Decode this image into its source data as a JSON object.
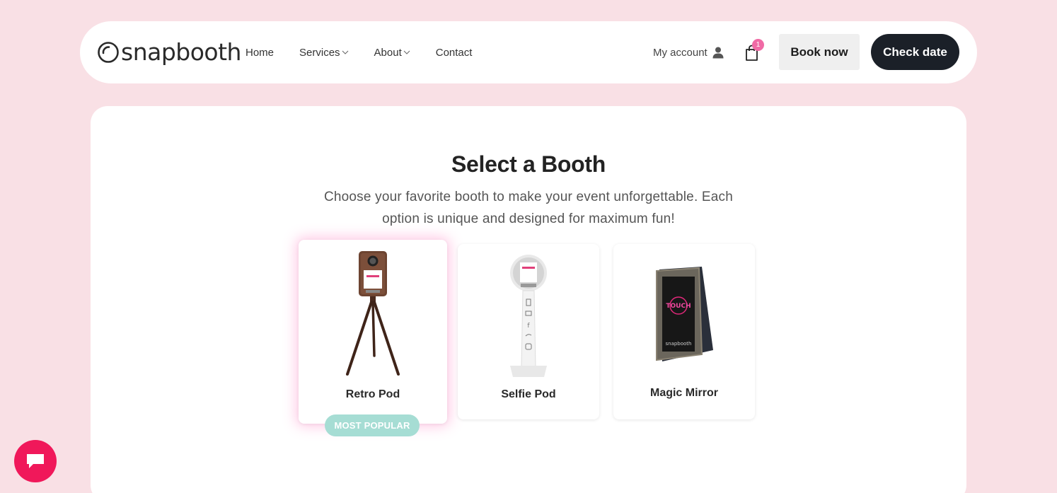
{
  "header": {
    "logo_text": "snapbooth",
    "nav": [
      {
        "label": "Home",
        "has_dropdown": false
      },
      {
        "label": "Services",
        "has_dropdown": true
      },
      {
        "label": "About",
        "has_dropdown": true
      },
      {
        "label": "Contact",
        "has_dropdown": false
      }
    ],
    "account_label": "My account",
    "cart_count": "1",
    "book_now_label": "Book now",
    "check_date_label": "Check date"
  },
  "main": {
    "title": "Select a Booth",
    "subtitle": "Choose your favorite booth to make your event unforgettable. Each option is unique and designed for maximum fun!",
    "booths": [
      {
        "name": "Retro Pod",
        "badge": "MOST POPULAR",
        "featured": true
      },
      {
        "name": "Selfie Pod",
        "featured": false
      },
      {
        "name": "Magic Mirror",
        "featured": false
      }
    ]
  },
  "colors": {
    "page_bg": "#f9e0e5",
    "dark_button": "#1b2028",
    "badge": "#a6ddd4",
    "cart_badge": "#f06aa5",
    "chat": "#f0185a"
  },
  "icons": [
    "logo-mark-icon",
    "chevron-down-icon",
    "user-icon",
    "shopping-bag-icon",
    "chat-icon"
  ]
}
